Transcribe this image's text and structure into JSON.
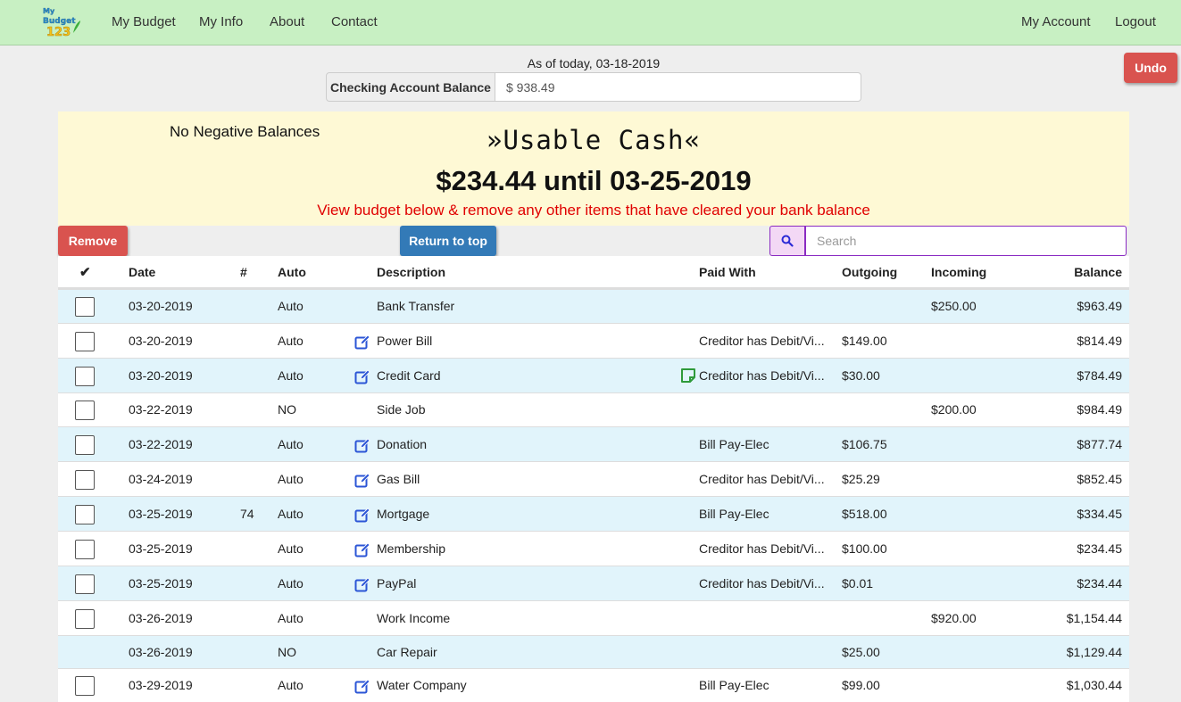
{
  "nav": {
    "logo_text": "My Budget 123",
    "links": [
      "My Budget",
      "My Info",
      "About",
      "Contact"
    ],
    "right_links": [
      "My Account",
      "Logout"
    ]
  },
  "balance": {
    "as_of": "As of today, 03-18-2019",
    "label": "Checking Account Balance",
    "value": "$ 938.49"
  },
  "undo_label": "Undo",
  "banner": {
    "no_negative": "No Negative Balances",
    "title": "»Usable Cash«",
    "amount": "$234.44 until 03-25-2019",
    "warning": "View budget below & remove any other items that have cleared your bank balance"
  },
  "toolbar": {
    "remove_label": "Remove",
    "top_label": "Return to top",
    "search_placeholder": "Search"
  },
  "table": {
    "headers": {
      "check": "✔",
      "date": "Date",
      "num": "#",
      "auto": "Auto",
      "description": "Description",
      "paid_with": "Paid With",
      "outgoing": "Outgoing",
      "incoming": "Incoming",
      "balance": "Balance"
    },
    "rows": [
      {
        "date": "03-20-2019",
        "num": "",
        "auto": "Auto",
        "edit": false,
        "desc": "Bank Transfer",
        "note": false,
        "paid": "",
        "out": "",
        "in": "$250.00",
        "bal": "$963.49",
        "check": true
      },
      {
        "date": "03-20-2019",
        "num": "",
        "auto": "Auto",
        "edit": true,
        "desc": "Power Bill",
        "note": false,
        "paid": "Creditor has Debit/Vi...",
        "out": "$149.00",
        "in": "",
        "bal": "$814.49",
        "check": true
      },
      {
        "date": "03-20-2019",
        "num": "",
        "auto": "Auto",
        "edit": true,
        "desc": "Credit Card",
        "note": true,
        "paid": "Creditor has Debit/Vi...",
        "out": "$30.00",
        "in": "",
        "bal": "$784.49",
        "check": true
      },
      {
        "date": "03-22-2019",
        "num": "",
        "auto": "NO",
        "edit": false,
        "desc": "Side Job",
        "note": false,
        "paid": "",
        "out": "",
        "in": "$200.00",
        "bal": "$984.49",
        "check": true
      },
      {
        "date": "03-22-2019",
        "num": "",
        "auto": "Auto",
        "edit": true,
        "desc": "Donation",
        "note": false,
        "paid": "Bill Pay-Elec",
        "out": "$106.75",
        "in": "",
        "bal": "$877.74",
        "check": true
      },
      {
        "date": "03-24-2019",
        "num": "",
        "auto": "Auto",
        "edit": true,
        "desc": "Gas Bill",
        "note": false,
        "paid": "Creditor has Debit/Vi...",
        "out": "$25.29",
        "in": "",
        "bal": "$852.45",
        "check": true
      },
      {
        "date": "03-25-2019",
        "num": "74",
        "auto": "Auto",
        "edit": true,
        "desc": "Mortgage",
        "note": false,
        "paid": "Bill Pay-Elec",
        "out": "$518.00",
        "in": "",
        "bal": "$334.45",
        "check": true
      },
      {
        "date": "03-25-2019",
        "num": "",
        "auto": "Auto",
        "edit": true,
        "desc": "Membership",
        "note": false,
        "paid": "Creditor has Debit/Vi...",
        "out": "$100.00",
        "in": "",
        "bal": "$234.45",
        "check": true
      },
      {
        "date": "03-25-2019",
        "num": "",
        "auto": "Auto",
        "edit": true,
        "desc": "PayPal",
        "note": false,
        "paid": "Creditor has Debit/Vi...",
        "out": "$0.01",
        "in": "",
        "bal": "$234.44",
        "check": true
      },
      {
        "date": "03-26-2019",
        "num": "",
        "auto": "Auto",
        "edit": false,
        "desc": "Work Income",
        "note": false,
        "paid": "",
        "out": "",
        "in": "$920.00",
        "bal": "$1,154.44",
        "check": true
      },
      {
        "date": "03-26-2019",
        "num": "",
        "auto": "NO",
        "edit": false,
        "desc": "Car Repair",
        "note": false,
        "paid": "",
        "out": "$25.00",
        "in": "",
        "bal": "$1,129.44",
        "check": false
      },
      {
        "date": "03-29-2019",
        "num": "",
        "auto": "Auto",
        "edit": true,
        "desc": "Water Company",
        "note": false,
        "paid": "Bill Pay-Elec",
        "out": "$99.00",
        "in": "",
        "bal": "$1,030.44",
        "check": true
      }
    ]
  },
  "colors": {
    "navbar": "#c8f0c3",
    "banner": "#fef9d5",
    "danger": "#d9534f",
    "primary": "#337ab7",
    "row_alt": "#e1f4fb",
    "warning_text": "#e00000",
    "edit_icon": "#2b55d6",
    "note_icon": "#2e9a3a"
  },
  "icons": {
    "edit": "pencil-square-icon",
    "note": "sticky-note-icon",
    "search": "magnifier-icon"
  }
}
